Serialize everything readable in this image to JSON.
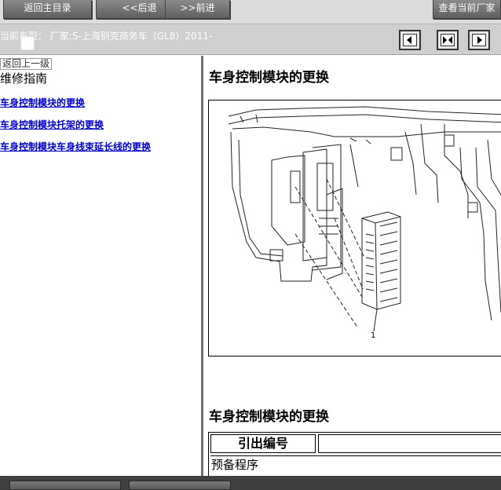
{
  "toolbar": {
    "btn_home": "返回主目录",
    "btn_back": "<<后退",
    "btn_forward": ">>前进",
    "btn_view": "查看当前厂家"
  },
  "vehicle_bar": {
    "text": "当前车型： 厂家:S-上海别克商务车（GL8）2011-"
  },
  "nav_icons": [
    "collapse-left-icon",
    "split-view-icon",
    "collapse-right-icon"
  ],
  "left_panel": {
    "back_link": "返回上一级",
    "title": "维修指南",
    "links": [
      "车身控制模块的更换",
      "车身控制模块托架的更换",
      "车身控制模块车身线束延长线的更换"
    ]
  },
  "content": {
    "heading_1": "车身控制模块的更换",
    "figure_callout": "1",
    "heading_2": "车身控制模块的更换",
    "table": {
      "header_col1": "引出编号",
      "header_col2": "",
      "row1": "预备程序"
    }
  }
}
